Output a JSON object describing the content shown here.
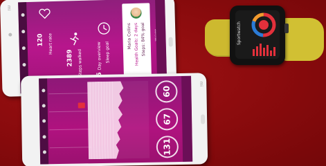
{
  "phone_top": {
    "brand": "mi",
    "stats": [
      "120",
      "2389",
      "15"
    ],
    "profile": {
      "name": "Maria Collins",
      "line1": "Health Goals: 2 days",
      "line2": "Steps: 84% goal"
    },
    "labels": [
      "Heart rate",
      "Steps walked",
      "Day overview",
      "Sleep goal",
      "Weight"
    ]
  },
  "phone_bottom": {
    "brand": "mi",
    "gauge_values": [
      "60",
      "67",
      "131"
    ]
  },
  "watch": {
    "title": "Sportwatch"
  },
  "colors": {
    "background": "#8f0d0d",
    "screen_magenta": "#b7168c",
    "strap_yellow": "#d7c536",
    "accent_red": "#e3303b",
    "accent_blue": "#2b7bd6",
    "accent_orange": "#f29a2e"
  },
  "icons": {
    "nav_items": [
      "home-icon",
      "heart-icon",
      "steps-icon",
      "chart-icon",
      "settings-icon"
    ]
  }
}
